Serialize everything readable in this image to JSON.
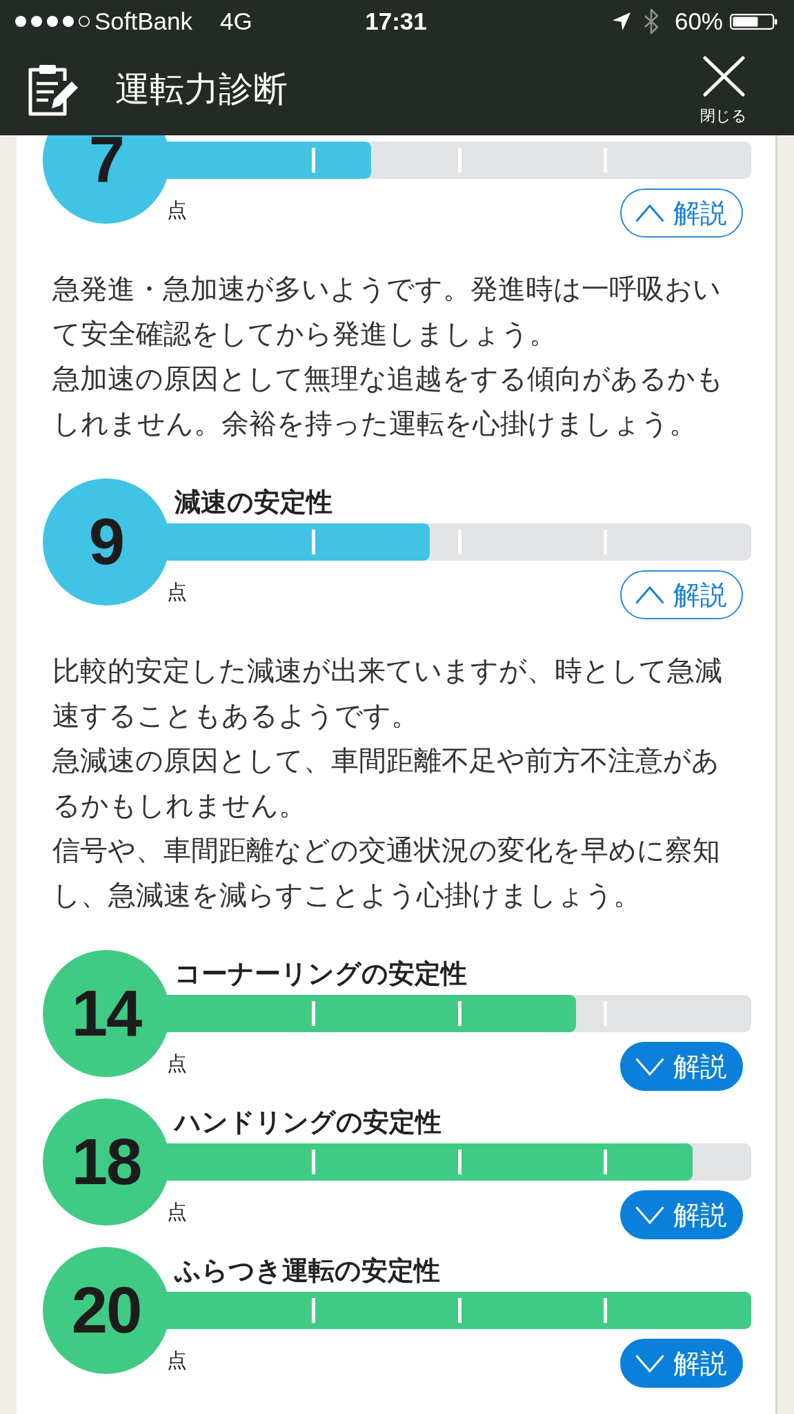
{
  "status_bar": {
    "carrier": "SoftBank",
    "network": "4G",
    "time": "17:31",
    "battery": "60%"
  },
  "header": {
    "title": "運転力診断",
    "close_label": "閉じる"
  },
  "sections": [
    {
      "score": "7",
      "unit": "点",
      "level": 0.35,
      "color": "#41c3e6",
      "button": {
        "label": "解説",
        "expanded": true
      },
      "description": [
        "急発進・急加速が多いようです。発進時は一呼吸おいて安全確認をしてから発進しましょう。",
        "急加速の原因として無理な追越をする傾向があるかもしれません。余裕を持った運転を心掛けましょう。"
      ]
    },
    {
      "title": "減速の安定性",
      "score": "9",
      "unit": "点",
      "level": 0.45,
      "color": "#41c3e6",
      "button": {
        "label": "解説",
        "expanded": true
      },
      "description": [
        "比較的安定した減速が出来ていますが、時として急減速することもあるようです。",
        "急減速の原因として、車間距離不足や前方不注意があるかもしれません。",
        "信号や、車間距離などの交通状況の変化を早めに察知し、急減速を減らすことよう心掛けましょう。"
      ]
    },
    {
      "title": "コーナーリングの安定性",
      "score": "14",
      "unit": "点",
      "level": 0.7,
      "color": "#40cb84",
      "button": {
        "label": "解説",
        "expanded": false
      }
    },
    {
      "title": "ハンドリングの安定性",
      "score": "18",
      "unit": "点",
      "level": 0.9,
      "color": "#40cb84",
      "button": {
        "label": "解説",
        "expanded": false
      }
    },
    {
      "title": "ふらつき運転の安定性",
      "score": "20",
      "unit": "点",
      "level": 1,
      "color": "#40cb84",
      "button": {
        "label": "解説",
        "expanded": false
      }
    }
  ]
}
